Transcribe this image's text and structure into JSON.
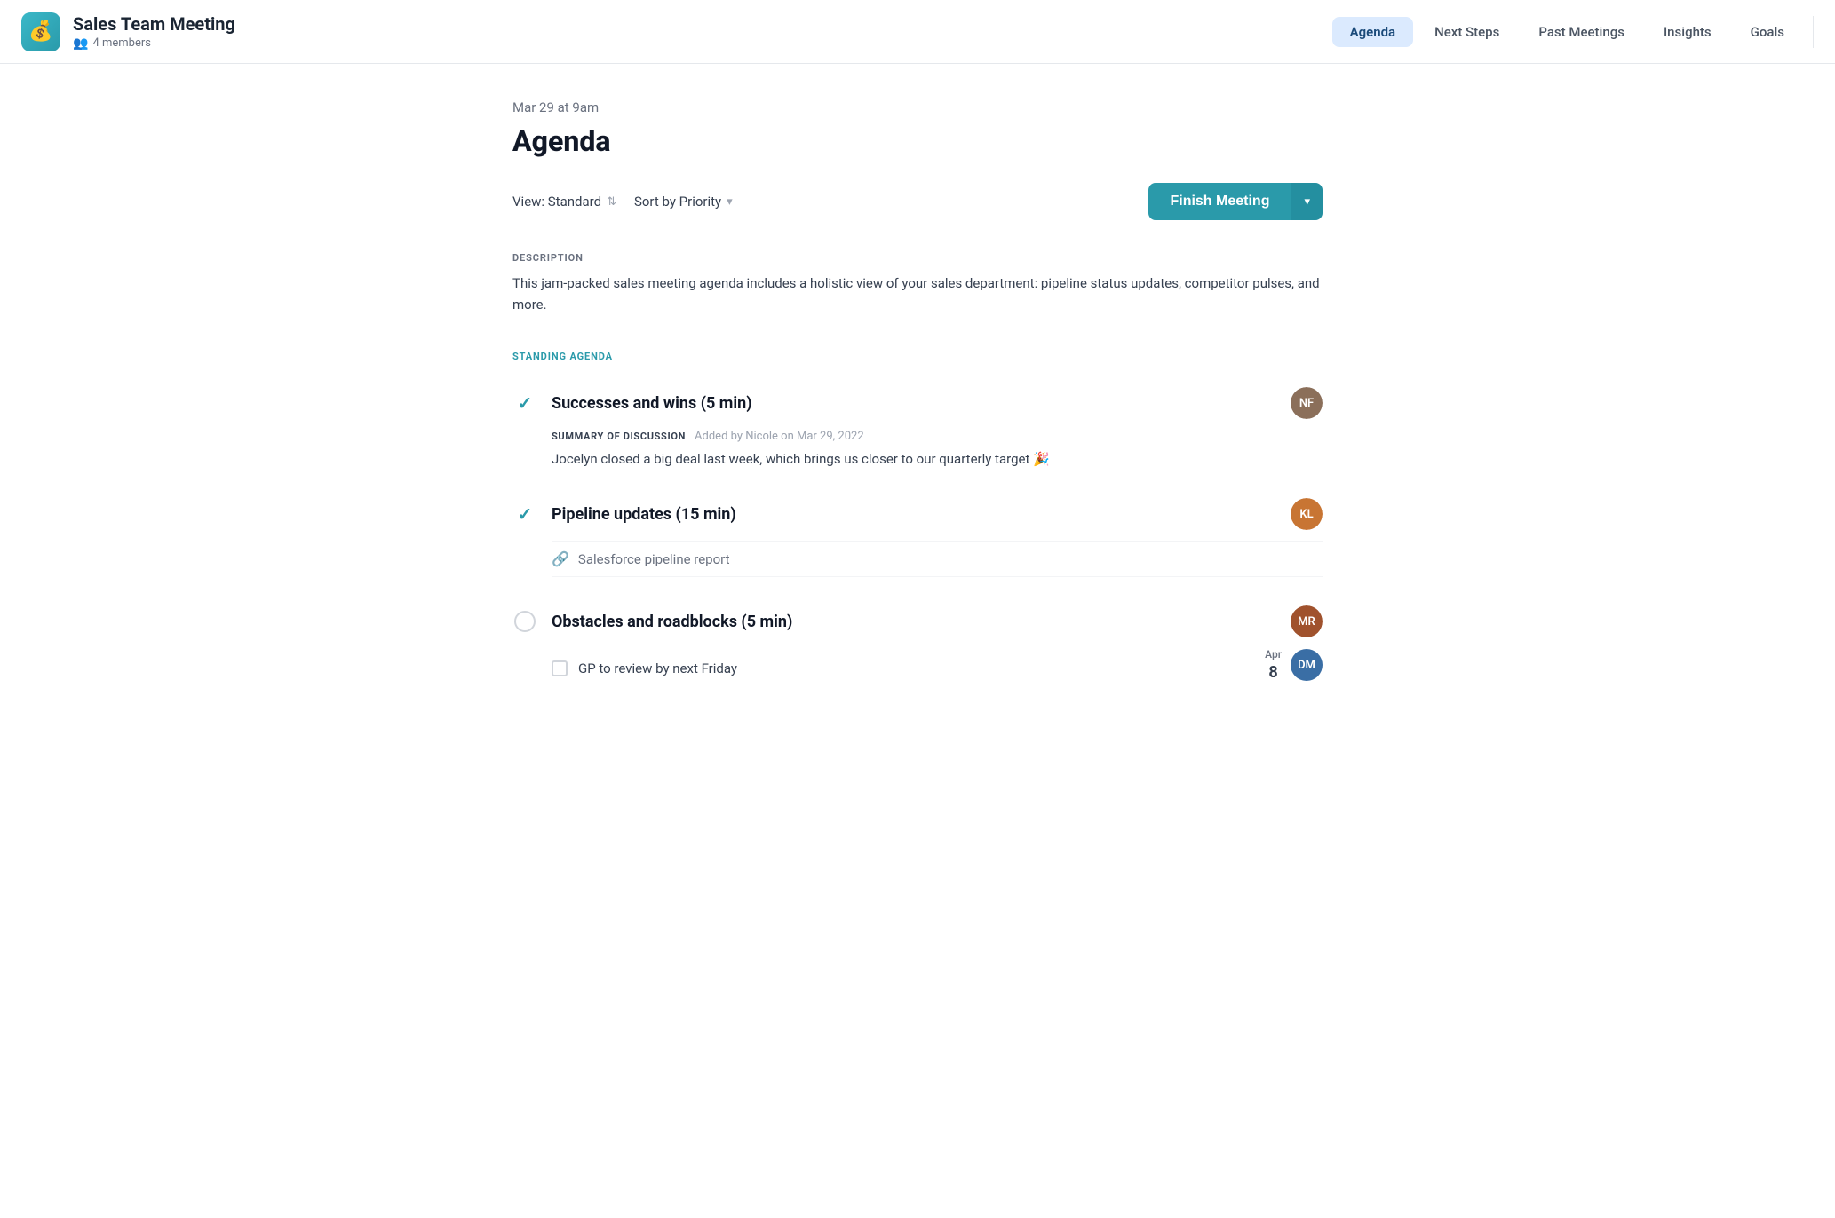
{
  "app": {
    "icon": "💰",
    "title": "Sales Team Meeting",
    "members_count": "4 members"
  },
  "nav": {
    "tabs": [
      {
        "id": "agenda",
        "label": "Agenda",
        "active": true
      },
      {
        "id": "next-steps",
        "label": "Next Steps",
        "active": false
      },
      {
        "id": "past-meetings",
        "label": "Past Meetings",
        "active": false
      },
      {
        "id": "insights",
        "label": "Insights",
        "active": false
      },
      {
        "id": "goals",
        "label": "Goals",
        "active": false
      }
    ]
  },
  "meeting": {
    "date": "Mar 29 at 9am",
    "title": "Agenda"
  },
  "toolbar": {
    "view_label": "View: Standard",
    "sort_label": "Sort by Priority",
    "finish_label": "Finish Meeting"
  },
  "description": {
    "section_label": "DESCRIPTION",
    "text": "This jam-packed sales meeting agenda includes a holistic view of your sales department: pipeline status updates, competitor pulses, and more."
  },
  "standing_agenda": {
    "section_label": "STANDING AGENDA",
    "items": [
      {
        "id": "item-1",
        "status": "checked",
        "title": "Successes and wins (5 min)",
        "avatar_initials": "NF",
        "avatar_class": "avatar-f1",
        "summary": {
          "label": "SUMMARY OF DISCUSSION",
          "meta": "Added by Nicole on Mar 29, 2022",
          "text": "Jocelyn closed a big deal last week, which brings us closer to our quarterly target 🎉"
        }
      },
      {
        "id": "item-2",
        "status": "checked",
        "title": "Pipeline updates (15 min)",
        "avatar_initials": "KL",
        "avatar_class": "avatar-f2",
        "link": {
          "label": "Salesforce pipeline report"
        }
      },
      {
        "id": "item-3",
        "status": "unchecked",
        "title": "Obstacles and roadblocks (5 min)",
        "avatar_initials": "MR",
        "avatar_class": "avatar-f1",
        "todo": {
          "text": "GP to review by next Friday",
          "date_month": "Apr",
          "date_day": "8",
          "avatar_initials": "DM",
          "avatar_class": "avatar-m1"
        }
      }
    ]
  }
}
